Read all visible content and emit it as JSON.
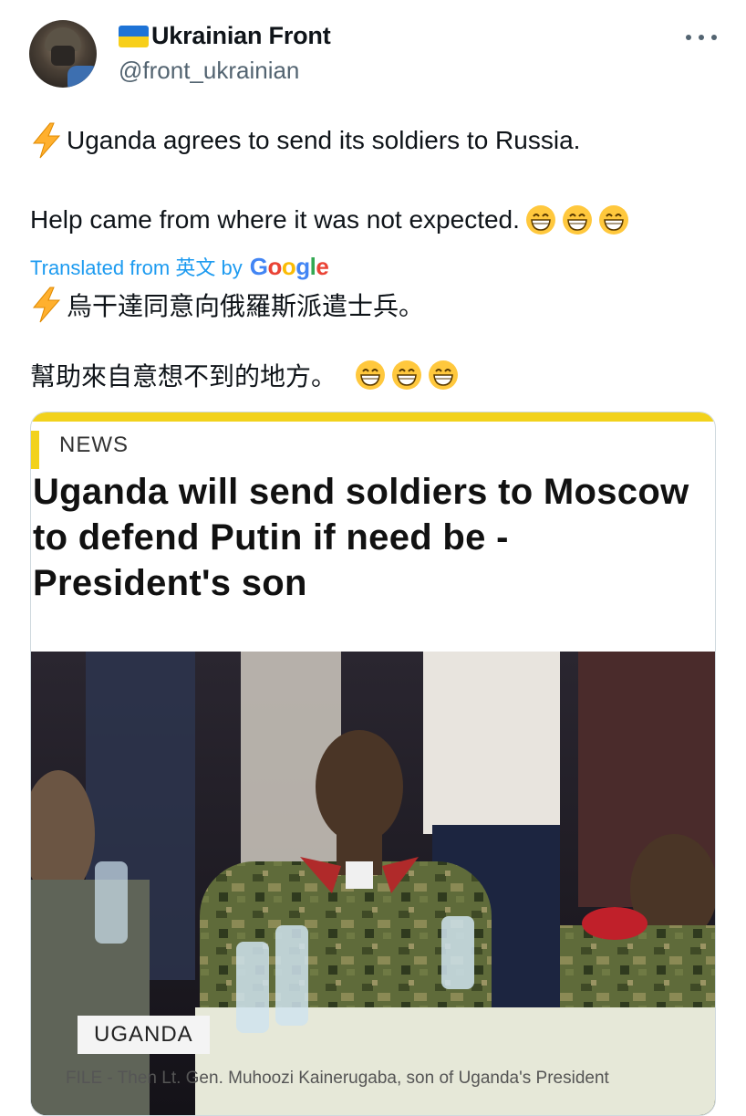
{
  "author": {
    "display_name": "Ukrainian Front",
    "handle": "@front_ukrainian",
    "flag": "ukraine-flag-icon",
    "avatar": "avatar-soldier"
  },
  "tweet": {
    "line1": "Uganda agrees to send its soldiers to Russia.",
    "line2": "Help came from where it was not expected.",
    "translated_label": "Translated from 英文 by",
    "translated_provider": "Google",
    "line3": "烏干達同意向俄羅斯派遣士兵。",
    "line4": "幫助來自意想不到的地方。"
  },
  "card": {
    "kicker": "NEWS",
    "headline": "Uganda will send soldiers to Moscow to defend Putin if need be - President's son",
    "photo_tag": "UGANDA",
    "caption": "FILE - Then Lt. Gen. Muhoozi Kainerugaba, son of Uganda's President",
    "accent_color": "#f2d21c"
  },
  "icons": {
    "more": "more-options-icon",
    "bolt": "lightning-icon",
    "emoji": "grinning-face-icon"
  }
}
